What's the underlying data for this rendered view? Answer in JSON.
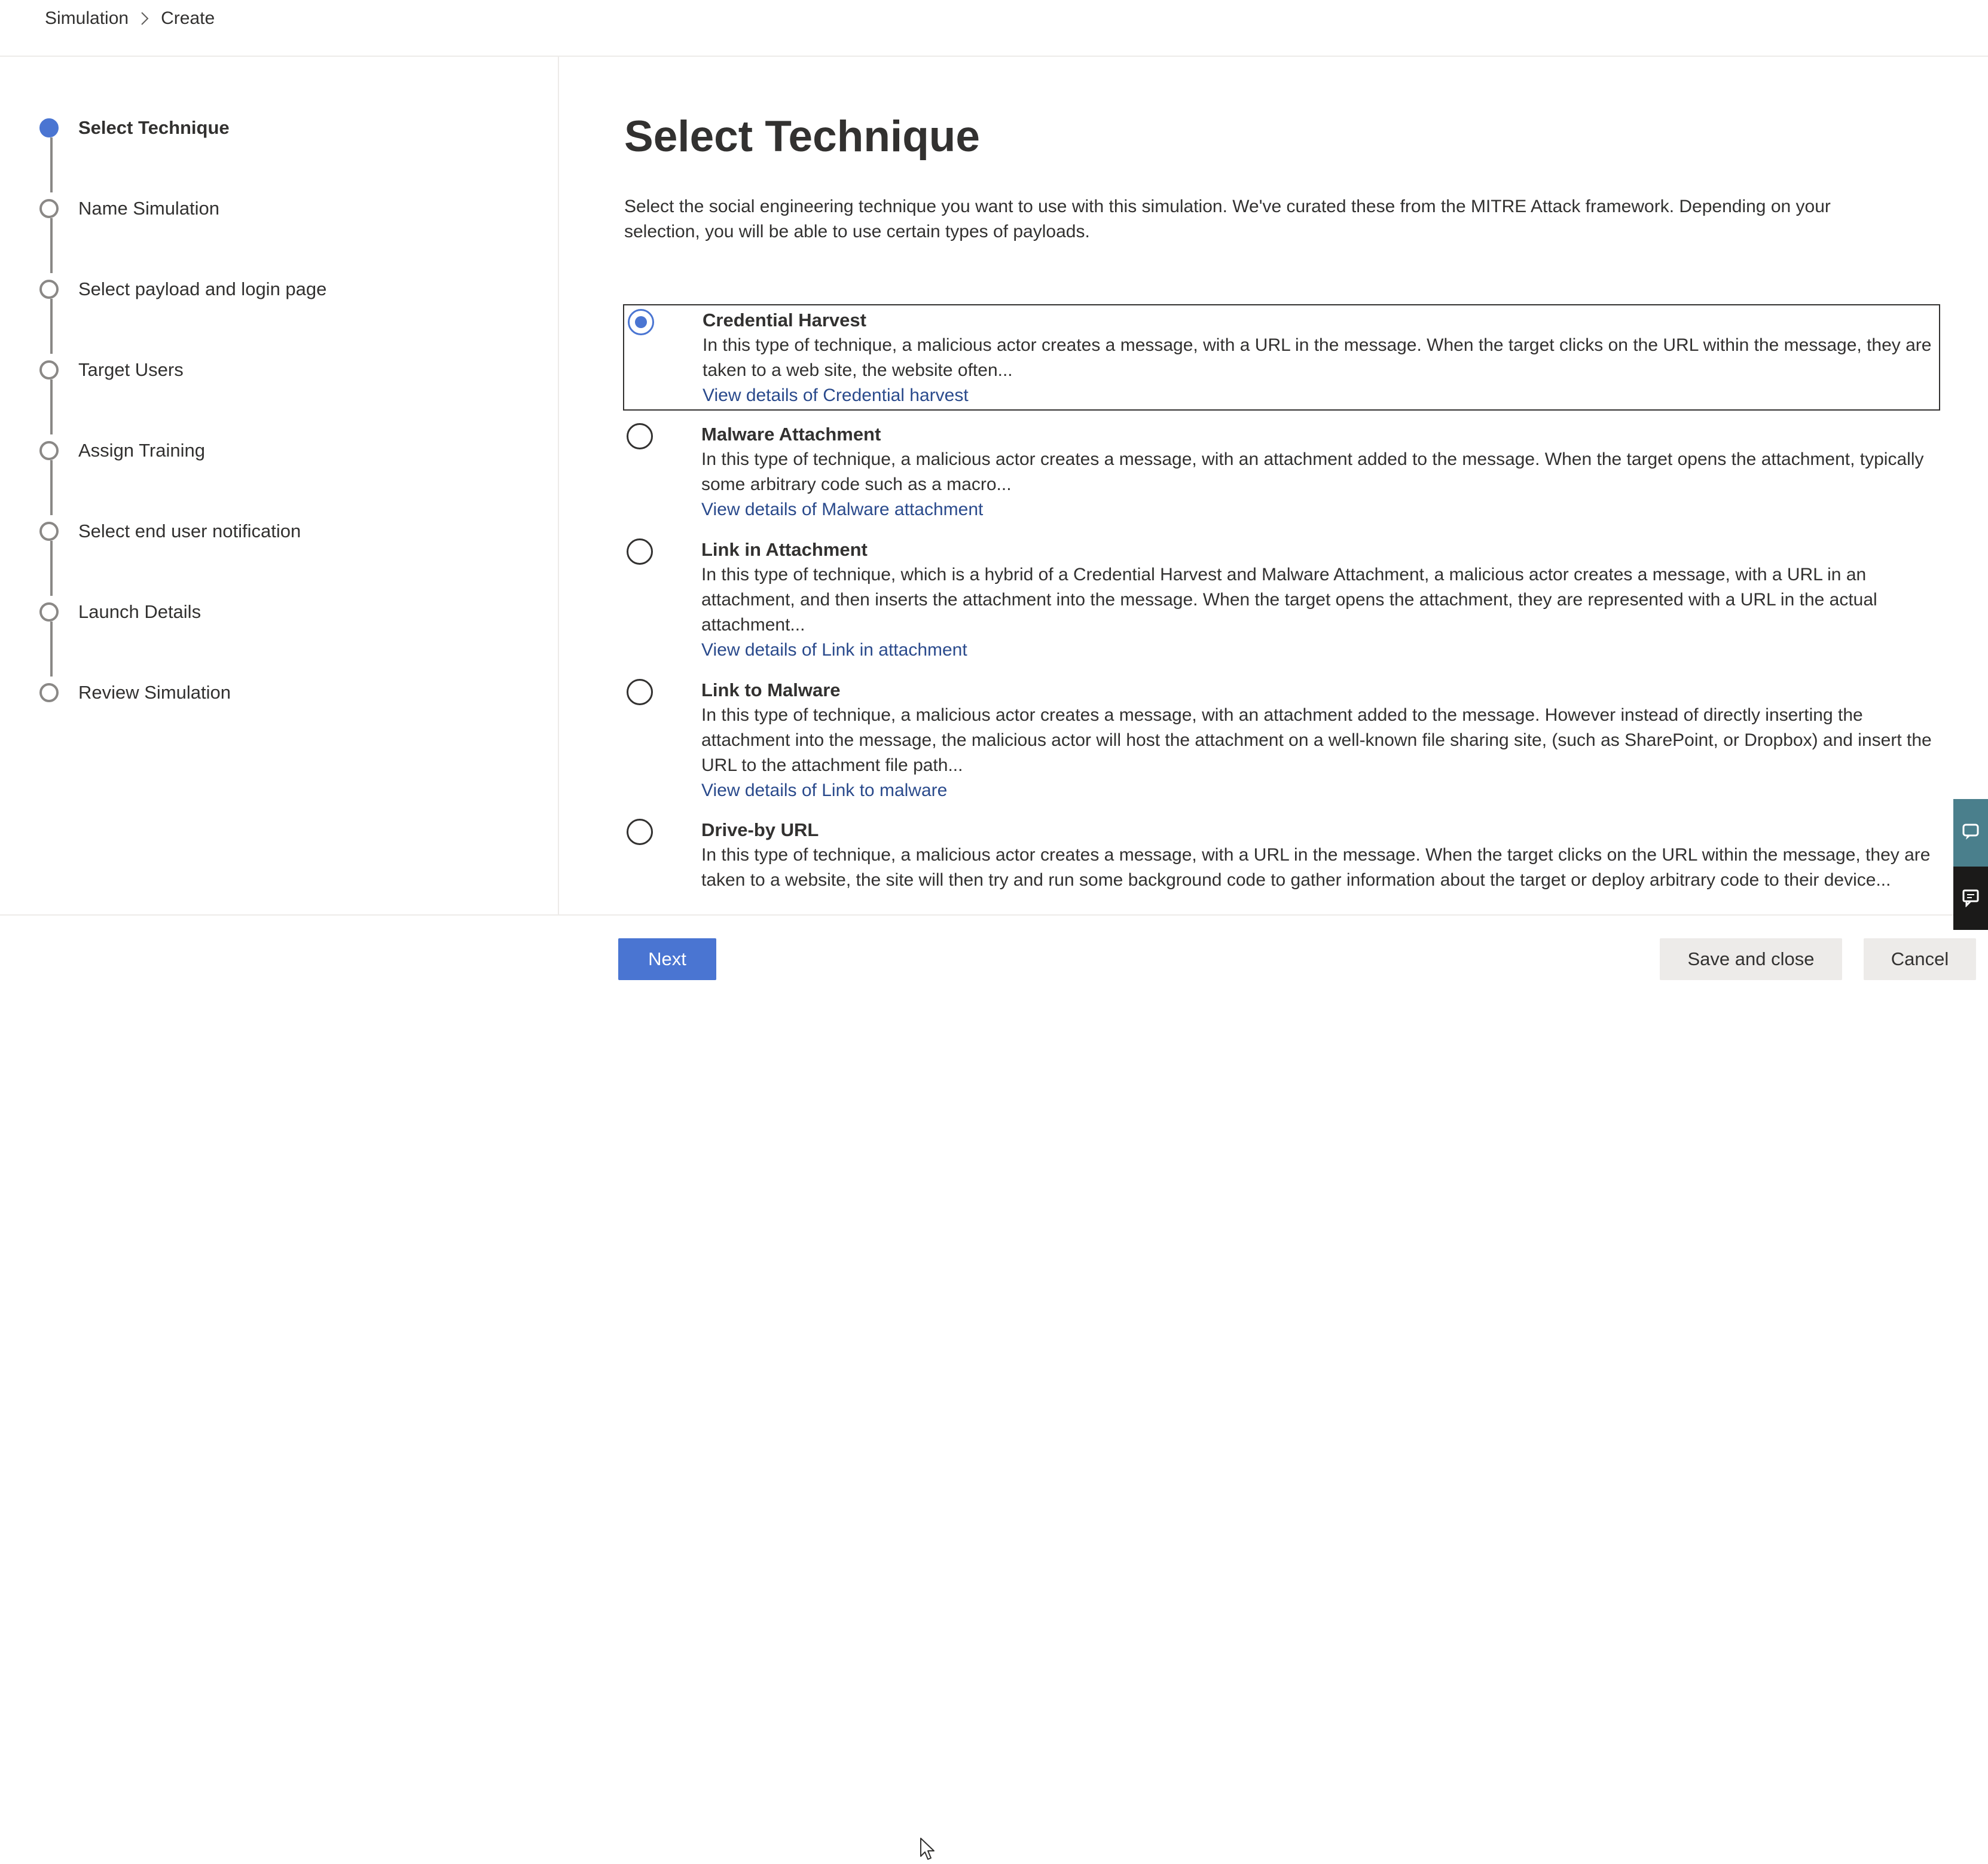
{
  "breadcrumb": {
    "items": [
      "Simulation",
      "Create"
    ]
  },
  "steps": [
    {
      "label": "Select Technique",
      "active": true
    },
    {
      "label": "Name Simulation",
      "active": false
    },
    {
      "label": "Select payload and login page",
      "active": false
    },
    {
      "label": "Target Users",
      "active": false
    },
    {
      "label": "Assign Training",
      "active": false
    },
    {
      "label": "Select end user notification",
      "active": false
    },
    {
      "label": "Launch Details",
      "active": false
    },
    {
      "label": "Review Simulation",
      "active": false
    }
  ],
  "main": {
    "title": "Select Technique",
    "description": "Select the social engineering technique you want to use with this simulation. We've curated these from the MITRE Attack framework. Depending on your selection, you will be able to use certain types of payloads."
  },
  "options": [
    {
      "title": "Credential Harvest",
      "description": "In this type of technique, a malicious actor creates a message, with a URL in the message. When the target clicks on the URL within the message, they are taken to a web site, the website often...",
      "link": "View details of Credential harvest",
      "selected": true
    },
    {
      "title": "Malware Attachment",
      "description": "In this type of technique, a malicious actor creates a message, with an attachment added to the message. When the target opens the attachment, typically some arbitrary code such as a macro...",
      "link": "View details of Malware attachment",
      "selected": false
    },
    {
      "title": "Link in Attachment",
      "description": "In this type of technique, which is a hybrid of a Credential Harvest and Malware Attachment, a malicious actor creates a message, with a URL in an attachment, and then inserts the attachment into the message. When the target opens the attachment, they are represented with a URL in the actual attachment...",
      "link": "View details of Link in attachment",
      "selected": false
    },
    {
      "title": "Link to Malware",
      "description": "In this type of technique, a malicious actor creates a message, with an attachment added to the message. However instead of directly inserting the attachment into the message, the malicious actor will host the attachment on a well-known file sharing site, (such as SharePoint, or Dropbox) and insert the URL to the attachment file path...",
      "link": "View details of Link to malware",
      "selected": false
    },
    {
      "title": "Drive-by URL",
      "description": "In this type of technique, a malicious actor creates a message, with a URL in the message. When the target clicks on the URL within the message, they are taken to a website, the site will then try and run some background code to gather information about the target or deploy arbitrary code to their device...",
      "link": "",
      "selected": false
    }
  ],
  "footer": {
    "next_label": "Next",
    "save_label": "Save and close",
    "cancel_label": "Cancel"
  },
  "colors": {
    "accent": "#4a75d2",
    "link": "#2a4a8c",
    "text": "#323130",
    "help_tab": "#4a7f8c",
    "feedback_tab": "#1b1a19"
  },
  "icons": [
    "chevron-right-icon",
    "cursor-icon",
    "help-chat-icon",
    "feedback-icon"
  ]
}
